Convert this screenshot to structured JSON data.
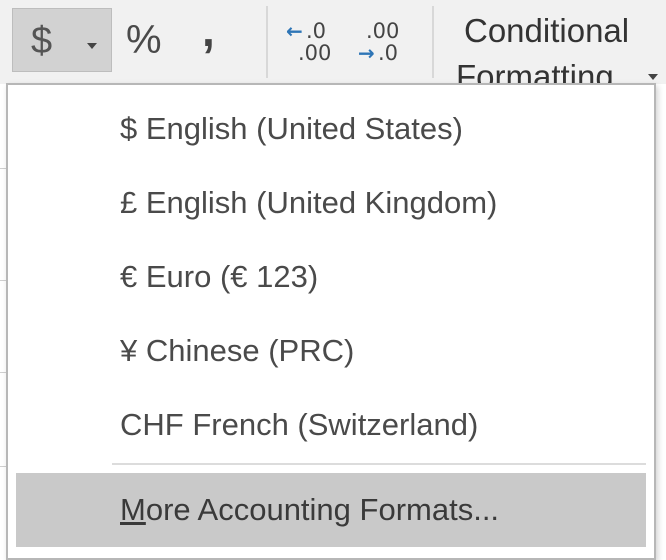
{
  "ribbon": {
    "accounting_symbol": "$",
    "percent_symbol": "%",
    "comma_symbol": ",",
    "increase_decimal": {
      "top": ".0",
      "bottom": ".00"
    },
    "decrease_decimal": {
      "top": ".00",
      "bottom": ".0"
    },
    "conditional_formatting": {
      "line1": "Conditional",
      "line2": "Formatting"
    }
  },
  "menu": {
    "items": [
      {
        "label": "$ English (United States)"
      },
      {
        "label": "£ English (United Kingdom)"
      },
      {
        "label": "€ Euro (€ 123)"
      },
      {
        "label": "¥ Chinese (PRC)"
      },
      {
        "label": "CHF French (Switzerland)"
      }
    ],
    "more": {
      "mnemonic": "M",
      "rest": "ore Accounting Formats..."
    }
  },
  "colors": {
    "hover_background": "#c9c9c9",
    "arrow_blue": "#2e75b6",
    "ribbon_background": "#f1f1f1"
  }
}
